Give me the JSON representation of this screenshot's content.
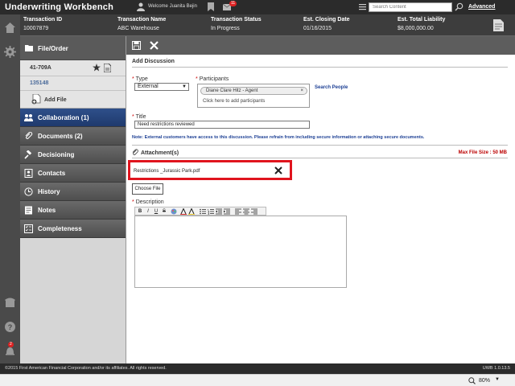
{
  "app": {
    "title": "Underwriting Workbench",
    "welcome": "Welcome Juanita Bejin",
    "mail_count": "11",
    "search_placeholder": "Search Content",
    "advanced_label": "Advanced",
    "notification_count": "2"
  },
  "transaction": {
    "columns": [
      {
        "label": "Transaction ID",
        "value": "10007879"
      },
      {
        "label": "Transaction Name",
        "value": "ABC Warehouse"
      },
      {
        "label": "Transaction Status",
        "value": "In Progress"
      },
      {
        "label": "Est. Closing Date",
        "value": "01/16/2015"
      },
      {
        "label": "Est. Total Liability",
        "value": "$8,000,000.00"
      }
    ]
  },
  "nav": {
    "header": "File/Order",
    "file_id": "41-709A",
    "file_sub": "135148",
    "add_file": "Add File",
    "items": [
      {
        "label": "Collaboration (1)",
        "icon": "collaboration-icon"
      },
      {
        "label": "Documents (2)",
        "icon": "paperclip-icon"
      },
      {
        "label": "Decisioning",
        "icon": "gavel-icon"
      },
      {
        "label": "Contacts",
        "icon": "contacts-icon"
      },
      {
        "label": "History",
        "icon": "clock-icon"
      },
      {
        "label": "Notes",
        "icon": "notes-icon"
      },
      {
        "label": "Completeness",
        "icon": "checklist-icon"
      }
    ]
  },
  "form": {
    "section_title": "Add Discussion",
    "required_mark": "*",
    "type_label": "Type",
    "type_value": "External",
    "participants_label": "Participants",
    "participant_chip": "Diane Clare Hitz - Agent",
    "chip_remove": "×",
    "participants_hint": "Click here to add participants",
    "search_people": "Search People",
    "title_label": "Title",
    "title_value": "Need restrictions reviewed",
    "note": "Note: External customers have access to this discussion. Please refrain from including secure information or attaching secure documents.",
    "attachments_label": "Attachment(s)",
    "max_size": "Max File Size : 50 MB",
    "attachment_name": "Restrictions _Jurassic Park.pdf",
    "choose_file": "Choose File",
    "description_label": "Description"
  },
  "editor_buttons": [
    "B",
    "I",
    "U",
    "S"
  ],
  "footer": {
    "copyright": "©2015 First American Financial Corporation and/or its affiliates. All rights reserved.",
    "version": "UWB 1.0.13.5"
  },
  "statusbar": {
    "zoom": "80%"
  },
  "colors": {
    "accent": "#1f3a6d",
    "highlight": "#e0141e"
  }
}
